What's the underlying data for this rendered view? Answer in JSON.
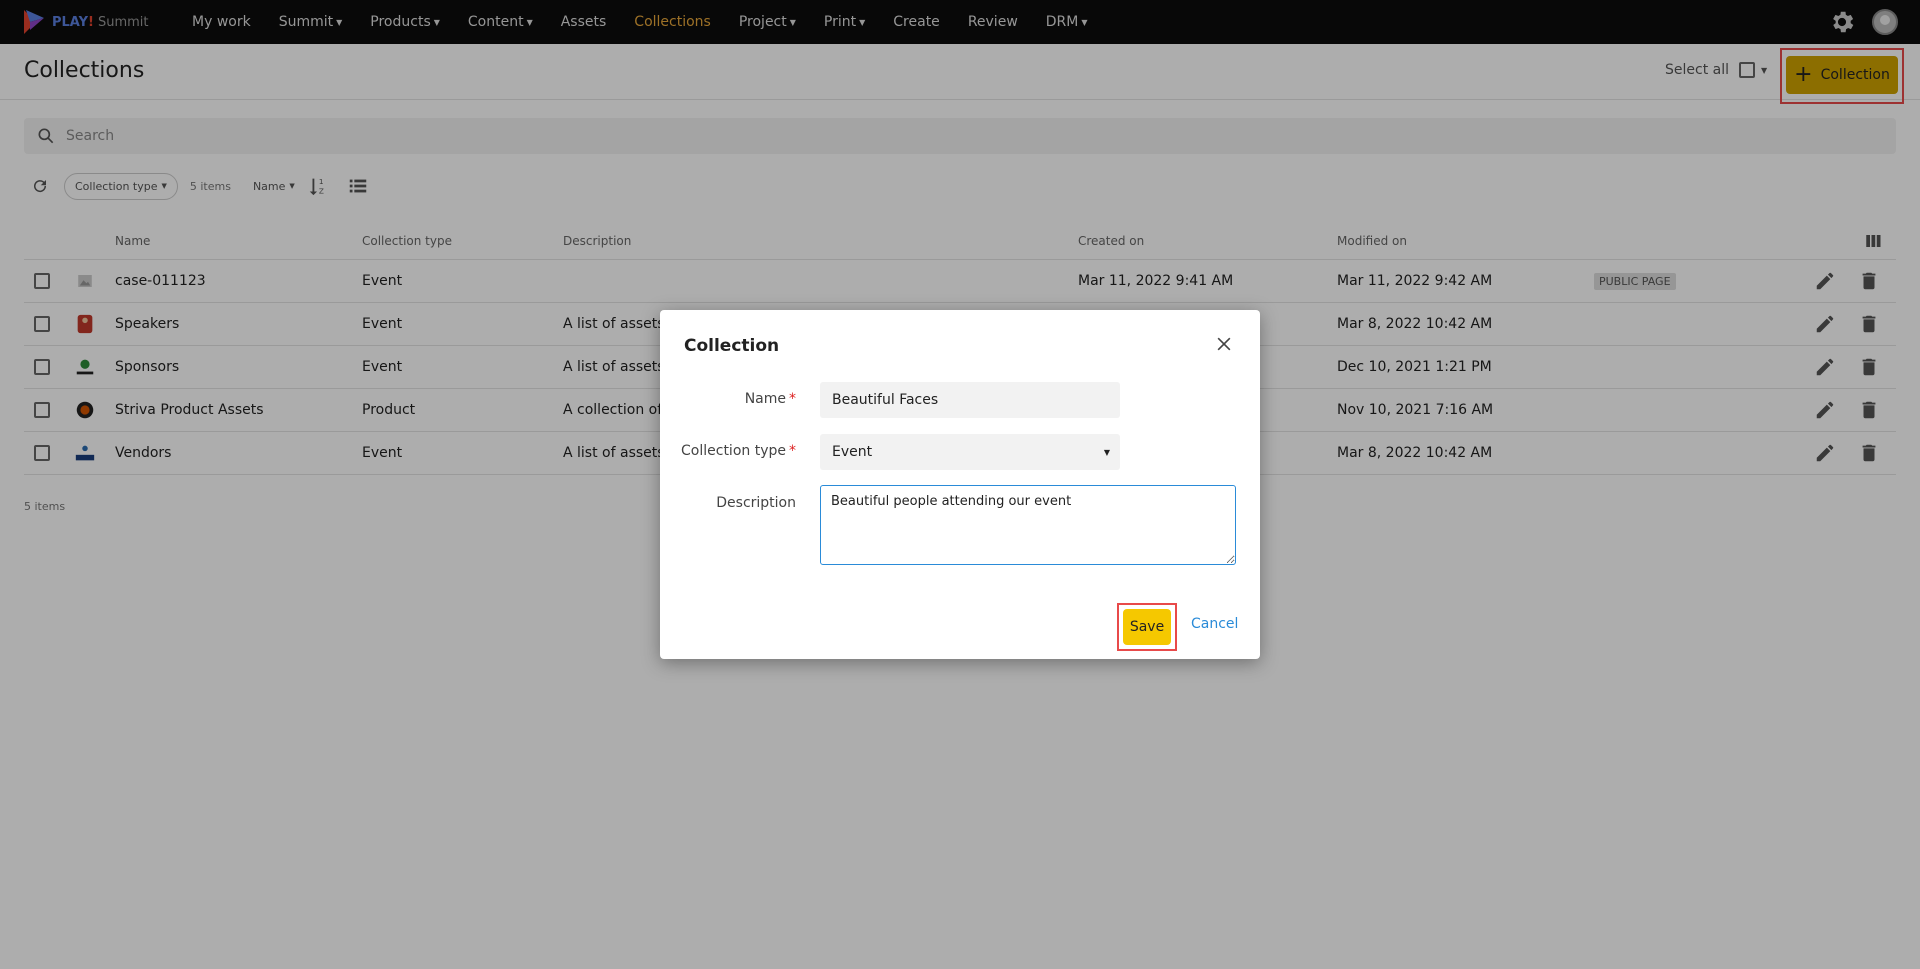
{
  "app": {
    "brand": "PLAY",
    "brand_ex": "!",
    "product": "Summit"
  },
  "nav": {
    "items": [
      {
        "label": "My work",
        "dropdown": false,
        "active": false
      },
      {
        "label": "Summit",
        "dropdown": true,
        "active": false
      },
      {
        "label": "Products",
        "dropdown": true,
        "active": false
      },
      {
        "label": "Content",
        "dropdown": true,
        "active": false
      },
      {
        "label": "Assets",
        "dropdown": false,
        "active": false
      },
      {
        "label": "Collections",
        "dropdown": false,
        "active": true
      },
      {
        "label": "Project",
        "dropdown": true,
        "active": false
      },
      {
        "label": "Print",
        "dropdown": true,
        "active": false
      },
      {
        "label": "Create",
        "dropdown": false,
        "active": false
      },
      {
        "label": "Review",
        "dropdown": false,
        "active": false
      },
      {
        "label": "DRM",
        "dropdown": true,
        "active": false
      }
    ]
  },
  "page": {
    "title": "Collections",
    "select_all_label": "Select all",
    "add_button_label": "Collection"
  },
  "search": {
    "placeholder": "Search"
  },
  "toolbar": {
    "collection_type_filter": "Collection type",
    "item_count": "5 items",
    "sort_field": "Name"
  },
  "table": {
    "headers": {
      "name": "Name",
      "type": "Collection type",
      "description": "Description",
      "created": "Created on",
      "modified": "Modified on"
    },
    "rows": [
      {
        "name": "case-011123",
        "type": "Event",
        "description": "",
        "created": "Mar 11, 2022 9:41 AM",
        "modified": "Mar 11, 2022 9:42 AM",
        "badge": "PUBLIC PAGE",
        "thumb": "placeholder-image-icon"
      },
      {
        "name": "Speakers",
        "type": "Event",
        "description": "A list of assets",
        "created": "",
        "modified": "Mar 8, 2022 10:42 AM",
        "badge": "",
        "thumb": "speaker-thumbnail"
      },
      {
        "name": "Sponsors",
        "type": "Event",
        "description": "A list of assets",
        "created": "",
        "modified": "Dec 10, 2021 1:21 PM",
        "badge": "",
        "thumb": "sponsor-logo-thumbnail"
      },
      {
        "name": "Striva Product Assets",
        "type": "Product",
        "description": "A collection of p",
        "created": "",
        "modified": "Nov 10, 2021 7:16 AM",
        "badge": "",
        "thumb": "product-thumbnail"
      },
      {
        "name": "Vendors",
        "type": "Event",
        "description": "A list of assets",
        "created": "",
        "modified": "Mar 8, 2022 10:42 AM",
        "badge": "",
        "thumb": "alba-logo-thumbnail"
      }
    ],
    "footer_count": "5 items"
  },
  "modal": {
    "title": "Collection",
    "name_label": "Name",
    "name_value": "Beautiful Faces",
    "type_label": "Collection type",
    "type_value": "Event",
    "description_label": "Description",
    "description_value": "Beautiful people attending our event",
    "save_label": "Save",
    "cancel_label": "Cancel"
  },
  "colors": {
    "nav_bg": "#0d0d0d",
    "nav_active": "#e8a73a",
    "primary_button": "#cfa300",
    "save_button": "#f5c800",
    "highlight_border": "#e84a4a",
    "link": "#2a8bd8"
  }
}
